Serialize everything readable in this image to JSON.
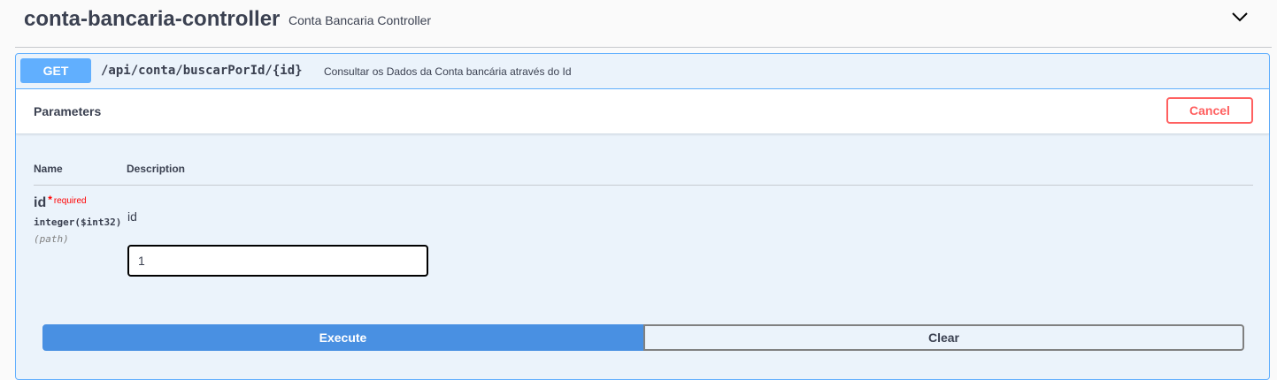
{
  "tag": {
    "title": "conta-bancaria-controller",
    "description": "Conta Bancaria Controller",
    "toggle_icon": "chevron-down-icon"
  },
  "operation": {
    "method": "GET",
    "path": "/api/conta/buscarPorId/{id}",
    "summary": "Consultar os Dados da Conta bancária através do Id",
    "accent_color": "#61affe"
  },
  "parameters": {
    "title": "Parameters",
    "cancel_label": "Cancel",
    "columns": {
      "name": "Name",
      "description": "Description"
    },
    "items": [
      {
        "name": "id",
        "required_marker": "*",
        "required_label": "required",
        "type": "integer($int32)",
        "in": "(path)",
        "description": "id",
        "value": "1"
      }
    ]
  },
  "actions": {
    "execute_label": "Execute",
    "clear_label": "Clear",
    "execute_color": "#4990e2",
    "cancel_color": "#ff6060"
  }
}
